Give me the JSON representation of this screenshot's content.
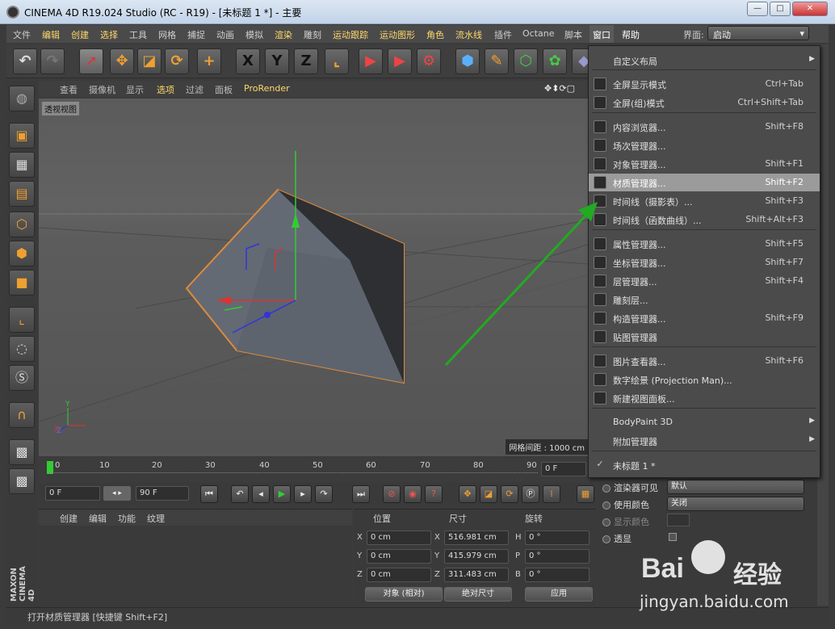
{
  "title": "CINEMA 4D R19.024 Studio (RC - R19) - [未标题 1 *] - 主要",
  "window_controls": {
    "minimize": "—",
    "maximize": "□",
    "close": "✕"
  },
  "menubar": {
    "items": [
      "文件",
      "编辑",
      "创建",
      "选择",
      "工具",
      "网格",
      "捕捉",
      "动画",
      "模拟",
      "渲染",
      "雕刻",
      "运动跟踪",
      "运动图形",
      "角色",
      "流水线",
      "插件",
      "Octane",
      "脚本",
      "窗口",
      "帮助"
    ],
    "layout_label": "界面:",
    "layout_value": "启动"
  },
  "toolbar": {
    "undo": "↶",
    "redo": "↷",
    "x_axis": "X",
    "y_axis": "Y",
    "z_axis": "Z"
  },
  "viewport_menu": {
    "items": [
      "查看",
      "摄像机",
      "显示",
      "选项",
      "过滤",
      "面板",
      "ProRender"
    ]
  },
  "viewport": {
    "label": "透视视图",
    "grid_spacing": "网格间距 : 1000 cm"
  },
  "timeline": {
    "ticks": [
      "0",
      "10",
      "20",
      "30",
      "40",
      "50",
      "60",
      "70",
      "80",
      "90"
    ],
    "current": "0 F"
  },
  "playback": {
    "start": "0 F",
    "end": "90 F"
  },
  "material_menu": [
    "创建",
    "编辑",
    "功能",
    "纹理"
  ],
  "coords": {
    "headers": [
      "位置",
      "尺寸",
      "旋转"
    ],
    "rows": [
      {
        "pl": "X",
        "pv": "0 cm",
        "sl": "X",
        "sv": "516.981 cm",
        "rl": "H",
        "rv": "0 °"
      },
      {
        "pl": "Y",
        "pv": "0 cm",
        "sl": "Y",
        "sv": "415.979 cm",
        "rl": "P",
        "rv": "0 °"
      },
      {
        "pl": "Z",
        "pv": "0 cm",
        "sl": "Z",
        "sv": "311.483 cm",
        "rl": "B",
        "rv": "0 °"
      }
    ],
    "mode": "对象 (相对)",
    "size_mode": "绝对尺寸",
    "apply": "应用"
  },
  "attributes": {
    "rows": [
      {
        "label": "渲染器可见",
        "value": "默认"
      },
      {
        "label": "使用颜色",
        "value": "关闭"
      },
      {
        "label": "显示颜色",
        "value": ""
      },
      {
        "label": "透显",
        "value": ""
      }
    ]
  },
  "dropdown": {
    "items": [
      {
        "label": "自定义布局",
        "shortcut": "",
        "arrow": true
      },
      {
        "label": "全屏显示模式",
        "shortcut": "Ctrl+Tab"
      },
      {
        "label": "全屏(组)模式",
        "shortcut": "Ctrl+Shift+Tab"
      },
      {
        "label": "内容浏览器...",
        "shortcut": "Shift+F8"
      },
      {
        "label": "场次管理器...",
        "shortcut": ""
      },
      {
        "label": "对象管理器...",
        "shortcut": "Shift+F1"
      },
      {
        "label": "材质管理器...",
        "shortcut": "Shift+F2",
        "highlighted": true
      },
      {
        "label": "时间线（摄影表）...",
        "shortcut": "Shift+F3"
      },
      {
        "label": "时间线（函数曲线）...",
        "shortcut": "Shift+Alt+F3"
      },
      {
        "label": "属性管理器...",
        "shortcut": "Shift+F5"
      },
      {
        "label": "坐标管理器...",
        "shortcut": "Shift+F7"
      },
      {
        "label": "层管理器...",
        "shortcut": "Shift+F4"
      },
      {
        "label": "雕刻层...",
        "shortcut": ""
      },
      {
        "label": "构造管理器...",
        "shortcut": "Shift+F9"
      },
      {
        "label": "贴图管理器",
        "shortcut": ""
      },
      {
        "label": "图片查看器...",
        "shortcut": "Shift+F6"
      },
      {
        "label": "数字绘景 (Projection Man)...",
        "shortcut": ""
      },
      {
        "label": "新建视图面板...",
        "shortcut": ""
      },
      {
        "label": "BodyPaint 3D",
        "shortcut": "",
        "arrow": true
      },
      {
        "label": "附加管理器",
        "shortcut": "",
        "arrow": true
      },
      {
        "label": "未标题 1 *",
        "shortcut": "",
        "check": true
      }
    ]
  },
  "status": "打开材质管理器 [快捷键 Shift+F2]",
  "brand": "MAXON CINEMA 4D",
  "watermark": {
    "line1": "Bai",
    "line2": "经验",
    "url": "jingyan.baidu.com"
  },
  "colors": {
    "highlight": "#ffd86a",
    "accent": "#f0a030",
    "arrow": "#22aa22"
  }
}
